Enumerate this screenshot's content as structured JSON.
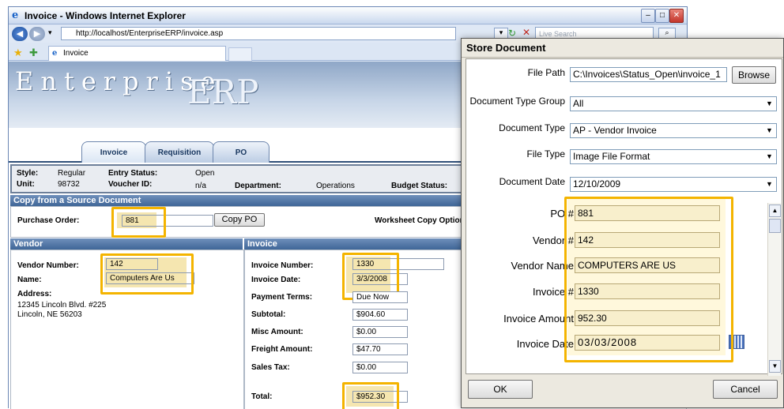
{
  "browser": {
    "title": "Invoice - Windows Internet Explorer",
    "address": "http://localhost/EnterpriseERP/invoice.asp",
    "search_placeholder": "Live Search",
    "tab_label": "Invoice"
  },
  "app": {
    "brand_left": "Enterprise",
    "brand_right": "ERP",
    "tabs": [
      "Invoice",
      "Requisition",
      "PO"
    ]
  },
  "info": {
    "style_label": "Style:",
    "style_value": "Regular",
    "entry_status_label": "Entry Status:",
    "entry_status_value": "Open",
    "unit_label": "Unit:",
    "unit_value": "98732",
    "voucher_label": "Voucher ID:",
    "voucher_value": "n/a",
    "department_label": "Department:",
    "department_value": "Operations",
    "budget_label": "Budget Status:"
  },
  "copy": {
    "header": "Copy from a Source Document",
    "po_label": "Purchase Order:",
    "po_value": "881",
    "copy_button": "Copy PO",
    "worksheet_label": "Worksheet Copy Options:"
  },
  "vendor": {
    "header": "Vendor",
    "number_label": "Vendor Number:",
    "number_value": "142",
    "name_label": "Name:",
    "name_value": "Computers Are Us",
    "address_label": "Address:",
    "address_line1": "12345 Lincoln Blvd. #225",
    "address_line2": "Lincoln, NE 56203"
  },
  "invoice": {
    "header": "Invoice",
    "number_label": "Invoice Number:",
    "number_value": "1330",
    "date_label": "Invoice Date:",
    "date_value": "3/3/2008",
    "terms_label": "Payment Terms:",
    "terms_value": "Due Now",
    "subtotal_label": "Subtotal:",
    "subtotal_value": "$904.60",
    "misc_label": "Misc Amount:",
    "misc_value": "$0.00",
    "freight_label": "Freight Amount:",
    "freight_value": "$47.70",
    "tax_label": "Sales Tax:",
    "tax_value": "$0.00",
    "total_label": "Total:",
    "total_value": "$952.30"
  },
  "dialog": {
    "title": "Store Document",
    "file_path_label": "File Path",
    "file_path_value": "C:\\Invoices\\Status_Open\\invoice_1",
    "browse_button": "Browse",
    "doc_type_group_label": "Document Type Group",
    "doc_type_group_value": "All",
    "doc_type_label": "Document Type",
    "doc_type_value": "AP - Vendor Invoice",
    "file_type_label": "File Type",
    "file_type_value": "Image File Format",
    "doc_date_label": "Document Date",
    "doc_date_value": "12/10/2009",
    "po_label": "PO #",
    "po_value": "881",
    "vendor_label": "Vendor #",
    "vendor_value": "142",
    "vendor_name_label": "Vendor Name",
    "vendor_name_value": "COMPUTERS ARE US",
    "invoice_label": "Invoice #",
    "invoice_value": "1330",
    "invoice_amount_label": "Invoice Amount",
    "invoice_amount_value": "952.30",
    "invoice_date_label": "Invoice Date",
    "invoice_date_value": "03/03/2008",
    "ok_button": "OK",
    "cancel_button": "Cancel"
  },
  "colors": {
    "highlight": "#f4b400",
    "section_header": "#3f6697",
    "banner": "#8fa7c7"
  }
}
